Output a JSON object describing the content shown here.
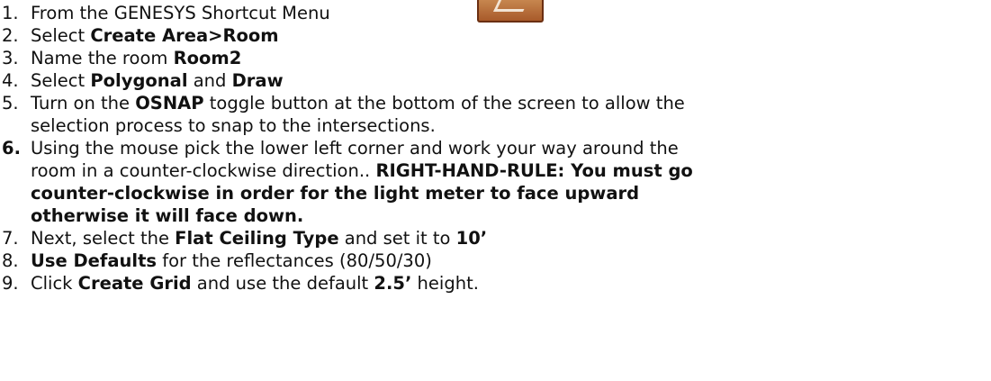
{
  "instructions": {
    "steps": [
      {
        "num": "1.",
        "parts": [
          {
            "t": "From the GENESYS Shortcut Menu ",
            "b": false
          }
        ]
      },
      {
        "num": "2.",
        "parts": [
          {
            "t": "Select ",
            "b": false
          },
          {
            "t": "Create Area>Room",
            "b": true
          }
        ]
      },
      {
        "num": "3.",
        "parts": [
          {
            "t": "Name the room ",
            "b": false
          },
          {
            "t": "Room2",
            "b": true
          }
        ]
      },
      {
        "num": "4.",
        "parts": [
          {
            "t": "Select ",
            "b": false
          },
          {
            "t": "Polygonal",
            "b": true
          },
          {
            "t": " and ",
            "b": false
          },
          {
            "t": "Draw",
            "b": true
          }
        ]
      },
      {
        "num": "5.",
        "lines": [
          [
            {
              "t": "Turn on the ",
              "b": false
            },
            {
              "t": "OSNAP",
              "b": true
            },
            {
              "t": " toggle button at the bottom of the screen to allow the",
              "b": false
            }
          ],
          [
            {
              "t": "selection process to snap to the intersections.",
              "b": false
            }
          ]
        ]
      },
      {
        "num": "6.",
        "num_bold": true,
        "lines": [
          [
            {
              "t": "Using the mouse pick the lower left corner and work your way around the",
              "b": false
            }
          ],
          [
            {
              "t": "room in a counter-clockwise direction..  ",
              "b": false
            },
            {
              "t": "RIGHT-HAND-RULE: You must go",
              "b": true
            }
          ],
          [
            {
              "t": "counter-clockwise in order for the light meter to face upward",
              "b": true
            }
          ],
          [
            {
              "t": "otherwise it will face down.",
              "b": true
            }
          ]
        ]
      },
      {
        "num": "7.",
        "parts": [
          {
            "t": "Next, select the ",
            "b": false
          },
          {
            "t": "Flat Ceiling Type",
            "b": true
          },
          {
            "t": " and set it to ",
            "b": false
          },
          {
            "t": "10’",
            "b": true
          }
        ]
      },
      {
        "num": "8.",
        "parts": [
          {
            "t": "Use Defaults",
            "b": true
          },
          {
            "t": " for the reflectances (80/50/30)",
            "b": false
          }
        ]
      },
      {
        "num": "9.",
        "parts": [
          {
            "t": "Click ",
            "b": false
          },
          {
            "t": "Create Grid",
            "b": true
          },
          {
            "t": " and use the default ",
            "b": false
          },
          {
            "t": "2.5’",
            "b": true
          },
          {
            "t": " height.",
            "b": false
          }
        ]
      }
    ],
    "icon": "genesys-shortcut-menu-icon"
  }
}
